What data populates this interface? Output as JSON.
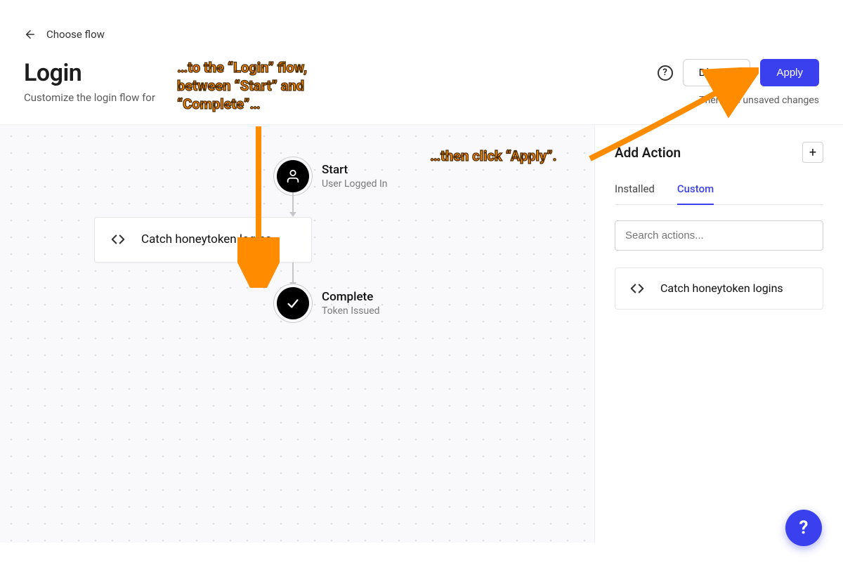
{
  "breadcrumb": {
    "label": "Choose flow"
  },
  "page": {
    "title": "Login",
    "subtitle": "Customize the login flow for"
  },
  "actions": {
    "discard": "Discard",
    "apply": "Apply",
    "unsaved": "There are unsaved changes"
  },
  "flow": {
    "start": {
      "title": "Start",
      "subtitle": "User Logged In"
    },
    "action": {
      "title": "Catch honeytoken logins"
    },
    "complete": {
      "title": "Complete",
      "subtitle": "Token Issued"
    }
  },
  "panel": {
    "title": "Add Action",
    "tabs": {
      "installed": "Installed",
      "custom": "Custom"
    },
    "search_placeholder": "Search actions...",
    "item": {
      "title": "Catch honeytoken logins"
    }
  },
  "annotations": {
    "a1_line1": "…to the “Login” flow,",
    "a1_line2": "between “Start” and",
    "a1_line3": "“Complete”…",
    "a2": "…then click “Apply”."
  }
}
